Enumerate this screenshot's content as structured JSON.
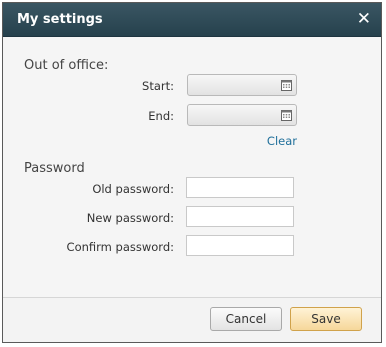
{
  "dialog": {
    "title": "My settings",
    "close_glyph": "✕"
  },
  "out_of_office": {
    "heading": "Out of office:",
    "start_label": "Start:",
    "start_value": "",
    "end_label": "End:",
    "end_value": "",
    "calendar_icon": "calendar-icon",
    "clear_label": "Clear"
  },
  "password": {
    "heading": "Password",
    "old_label": "Old password:",
    "old_value": "",
    "new_label": "New password:",
    "new_value": "",
    "confirm_label": "Confirm password:",
    "confirm_value": ""
  },
  "footer": {
    "cancel_label": "Cancel",
    "save_label": "Save"
  }
}
